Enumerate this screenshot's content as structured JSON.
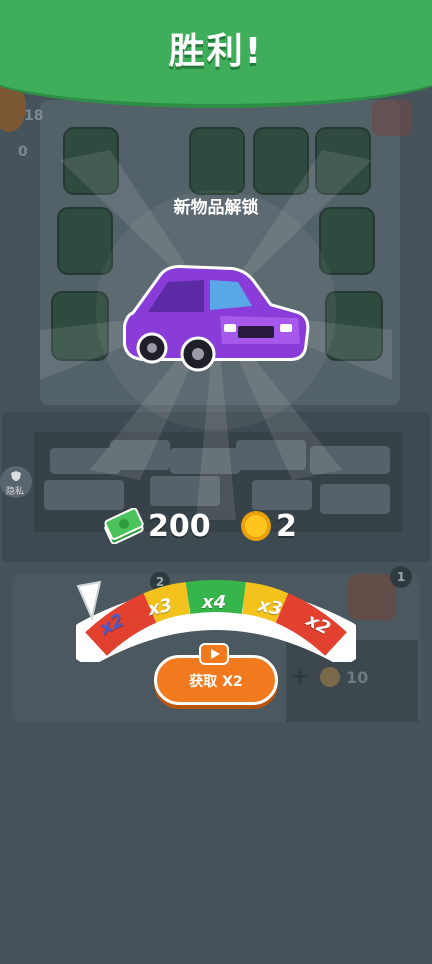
{
  "banner": {
    "title": "胜利!"
  },
  "unlock": {
    "text": "新物品解锁"
  },
  "reward": {
    "cash": "200",
    "coins": "2"
  },
  "multiplier": {
    "segments": [
      "x2",
      "x3",
      "x4",
      "x3",
      "x2"
    ]
  },
  "claim_button": {
    "label": "获取 X2"
  },
  "side": {
    "privacy": "隐私"
  },
  "hud": {
    "top_counter": "18",
    "left_counter": "0",
    "badge_left": "2",
    "badge_right": "1",
    "add_cost": "10"
  },
  "colors": {
    "banner": "#3fae5a",
    "button": "#f07a1d",
    "car": "#8a3cd9",
    "seg_red": "#e2412f",
    "seg_yellow": "#f3c21c",
    "seg_green": "#35b54a"
  }
}
